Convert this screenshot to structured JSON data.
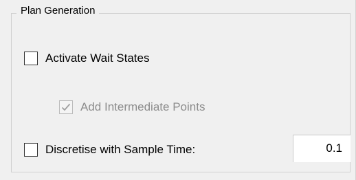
{
  "group": {
    "title": "Plan Generation"
  },
  "options": {
    "wait_states": {
      "label": "Activate Wait States",
      "checked": false,
      "enabled": true
    },
    "intermediate_points": {
      "label": "Add Intermediate Points",
      "checked": true,
      "enabled": false
    },
    "discretise": {
      "label": "Discretise with Sample Time:",
      "checked": false,
      "enabled": true,
      "sample_time": "0.1"
    }
  },
  "colors": {
    "panel_bg": "#f0f0f0",
    "disabled_text": "#8d8d8d",
    "check_mark_disabled": "#a0a0a0"
  }
}
